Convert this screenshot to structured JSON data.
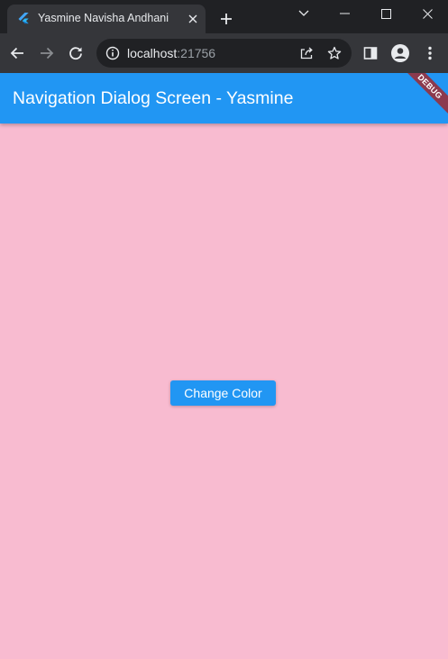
{
  "browser": {
    "tab": {
      "title": "Yasmine Navisha Andhani",
      "favicon": "flutter-icon"
    },
    "window_controls": [
      "chevron-down-icon",
      "minimize-icon",
      "maximize-icon",
      "close-icon"
    ],
    "toolbar": {
      "url_host": "localhost",
      "url_port": ":21756",
      "icons": [
        "back-arrow-icon",
        "forward-arrow-icon",
        "reload-icon",
        "info-icon",
        "share-icon",
        "star-icon",
        "side-panel-icon",
        "profile-icon",
        "kebab-menu-icon"
      ]
    },
    "colors": {
      "frame": "#202124",
      "toolbar": "#35363a"
    }
  },
  "app": {
    "appbar_title": "Navigation Dialog Screen - Yasmine",
    "debug_label": "DEBUG",
    "button_label": "Change Color",
    "colors": {
      "primary": "#2196f3",
      "background": "#f8bbd0",
      "debug_banner": "#8b3a4e"
    }
  }
}
